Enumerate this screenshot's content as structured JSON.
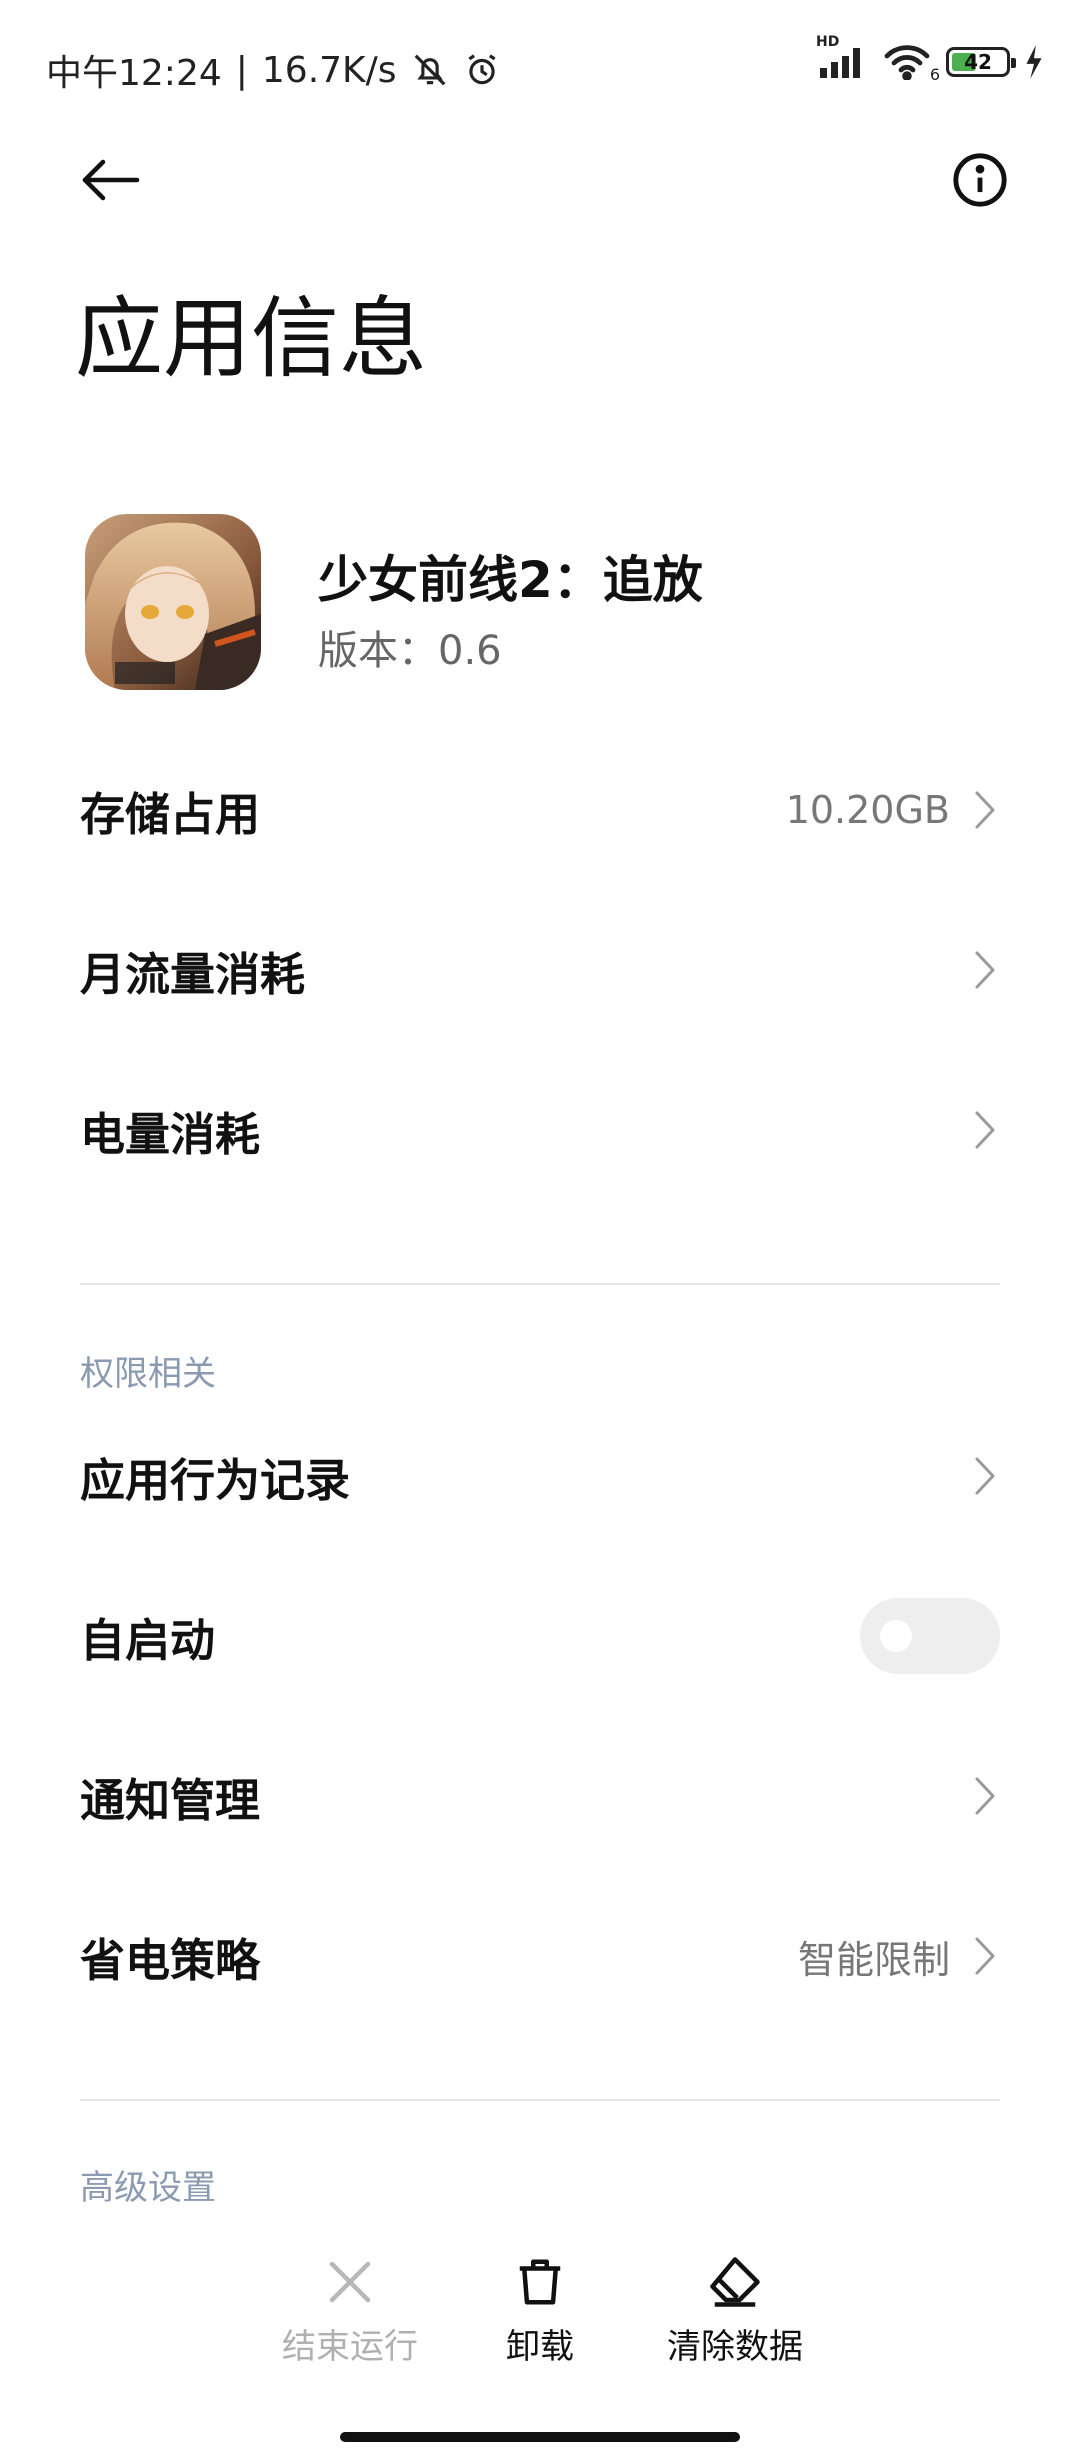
{
  "status_bar": {
    "time_text": "中午12:24",
    "separator": "|",
    "speed": "16.7K/s",
    "network_label": "HD",
    "wifi_label": "6",
    "battery_level": "42",
    "icons": [
      "bell-off-icon",
      "alarm-icon",
      "signal-icon",
      "wifi-icon",
      "battery-icon",
      "charging-icon"
    ]
  },
  "header": {
    "title": "应用信息",
    "back_icon": "arrow-left-icon",
    "info_icon": "info-icon"
  },
  "app": {
    "name": "少女前线2：追放",
    "version_label": "版本：",
    "version": "0.6"
  },
  "rows_usage": [
    {
      "label": "存储占用",
      "value": "10.20GB"
    },
    {
      "label": "月流量消耗",
      "value": ""
    },
    {
      "label": "电量消耗",
      "value": ""
    }
  ],
  "permissions": {
    "section_title": "权限相关",
    "behavior_log": {
      "label": "应用行为记录"
    },
    "autostart": {
      "label": "自启动",
      "enabled": false
    },
    "notifications": {
      "label": "通知管理"
    },
    "power_saving": {
      "label": "省电策略",
      "value": "智能限制"
    }
  },
  "advanced": {
    "section_title": "高级设置"
  },
  "actions": {
    "force_stop": {
      "label": "结束运行",
      "enabled": false,
      "icon": "close-icon"
    },
    "uninstall": {
      "label": "卸载",
      "enabled": true,
      "icon": "trash-icon"
    },
    "clear_data": {
      "label": "清除数据",
      "enabled": true,
      "icon": "eraser-icon"
    }
  },
  "colors": {
    "accent_section": "#8a9ab0",
    "battery_green": "#4caf50",
    "disabled_text": "#b0b0b0"
  }
}
